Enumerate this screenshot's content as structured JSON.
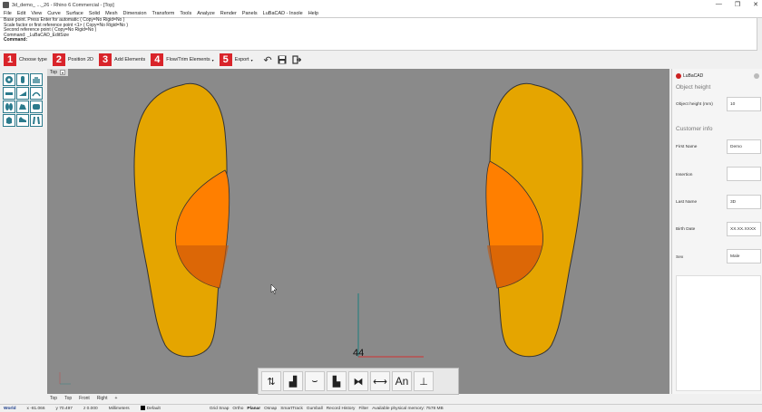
{
  "window": {
    "title": "3d_demo_ ..._26 - Rhino 6 Commercial - [Top]",
    "minimize": "—",
    "restore": "❐",
    "close": "✕"
  },
  "menu": [
    "File",
    "Edit",
    "View",
    "Curve",
    "Surface",
    "Solid",
    "Mesh",
    "Dimension",
    "Transform",
    "Tools",
    "Analyze",
    "Render",
    "Panels",
    "LuBaCAD - Insole",
    "Help"
  ],
  "command_history": [
    "Base point. Press Enter for automatic ( Copy=No  Rigid=No )",
    "Scale factor or first reference point <1> ( Copy=No  Rigid=No )",
    "Second reference point ( Copy=No  Rigid=No )",
    "Command: _LuBaCAD_EditSize",
    "Command:"
  ],
  "steps": [
    {
      "num": "1",
      "label": "Choose type",
      "dropdown": false
    },
    {
      "num": "2",
      "label": "Position 2D",
      "dropdown": false
    },
    {
      "num": "3",
      "label": "Add Elements",
      "dropdown": false
    },
    {
      "num": "4",
      "label": "Flow/Trim Elements",
      "dropdown": true
    },
    {
      "num": "5",
      "label": "Export",
      "dropdown": true
    }
  ],
  "toolbar_icons": [
    "undo-icon",
    "save-icon",
    "exit-icon"
  ],
  "viewport": {
    "label": "Top",
    "dimension_text": "44"
  },
  "colors": {
    "insole": "#e5a500",
    "pad": "#ff7f00",
    "viewport_bg": "#8a8a8a",
    "step_badge": "#d9242a",
    "tool_border": "#2b7a8c"
  },
  "left_tools": [
    "sphere-tool-icon",
    "foot-outline-icon",
    "foot-side-icon",
    "hand-icon",
    "toe-bar-icon",
    "heel-wedge-icon",
    "arch-icon",
    "foot-pair-icon",
    "box-icon",
    "footprint-icon",
    "shoe-icon",
    "feet-icon"
  ],
  "bottom_tools": [
    {
      "icon": "feet-align-icon",
      "glyph": "⇅"
    },
    {
      "icon": "foot-shape-icon",
      "glyph": "▟"
    },
    {
      "icon": "curve-offset-icon",
      "glyph": "⌣"
    },
    {
      "icon": "shoe-3d-icon",
      "glyph": "▙"
    },
    {
      "icon": "mirror-icon",
      "glyph": "⧓"
    },
    {
      "icon": "measure-icon",
      "glyph": "⟷"
    },
    {
      "icon": "annotation-icon",
      "glyph": "An"
    },
    {
      "icon": "pin-3d-icon",
      "glyph": "⊥"
    }
  ],
  "view_tabs": [
    "Top",
    "Top",
    "Front",
    "Right",
    "+"
  ],
  "status": {
    "world": "World",
    "x": "x -81.066",
    "y": "y 70.497",
    "z": "z 0.000",
    "units": "Millimeters",
    "layer": "Default",
    "grid_snap": "Grid Snap",
    "ortho": "Ortho",
    "planar": "Planar",
    "osnap": "Osnap",
    "smarttrack": "SmartTrack",
    "gumball": "Gumball",
    "record_history": "Record History",
    "filter": "Filter",
    "memory": "Available physical memory: 7578 MB"
  },
  "right_panel": {
    "title": "LuBaCAD",
    "object_height_section": "Object height",
    "object_height_label": "Object height (mm)",
    "object_height_value": "10",
    "customer_section": "Customer info",
    "first_name_label": "First Name",
    "first_name_value": "Demo",
    "insertion_label": "Insertion",
    "insertion_value": "",
    "last_name_label": "Last Name",
    "last_name_value": "3D",
    "birth_date_label": "Birth Date",
    "birth_date_value": "XX.XX.XXXX",
    "sex_label": "Sex",
    "sex_value": "Male"
  }
}
